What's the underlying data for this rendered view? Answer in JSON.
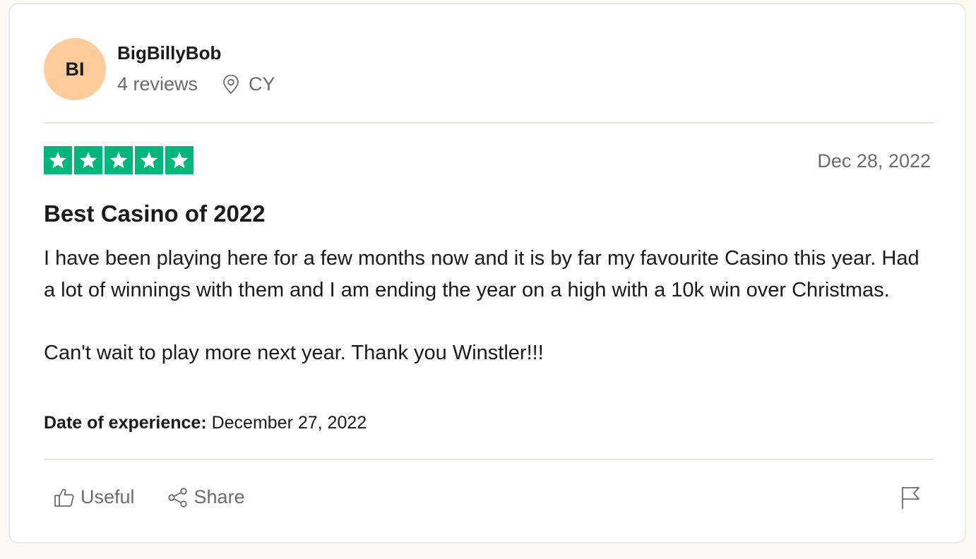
{
  "reviewer": {
    "initials": "BI",
    "avatar_color": "#fecb9b",
    "name": "BigBillyBob",
    "reviews_count": "4 reviews",
    "location_icon": "location-pin-icon",
    "country": "CY"
  },
  "review": {
    "rating": 5,
    "rating_max": 5,
    "star_color": "#00b67a",
    "date": "Dec 28, 2022",
    "title": "Best Casino of 2022",
    "body": [
      "I have been playing here for a few months now and it is by far my favourite Casino this year. Had a lot of winnings with them and I am ending the year on a high with a 10k win over Christmas.",
      "Can't wait to play more next year. Thank you Winstler!!!"
    ],
    "experience_label": "Date of experience:",
    "experience_date": "December 27, 2022"
  },
  "actions": {
    "useful_label": "Useful",
    "useful_icon": "thumbs-up-icon",
    "share_label": "Share",
    "share_icon": "share-icon",
    "report_icon": "flag-icon"
  }
}
